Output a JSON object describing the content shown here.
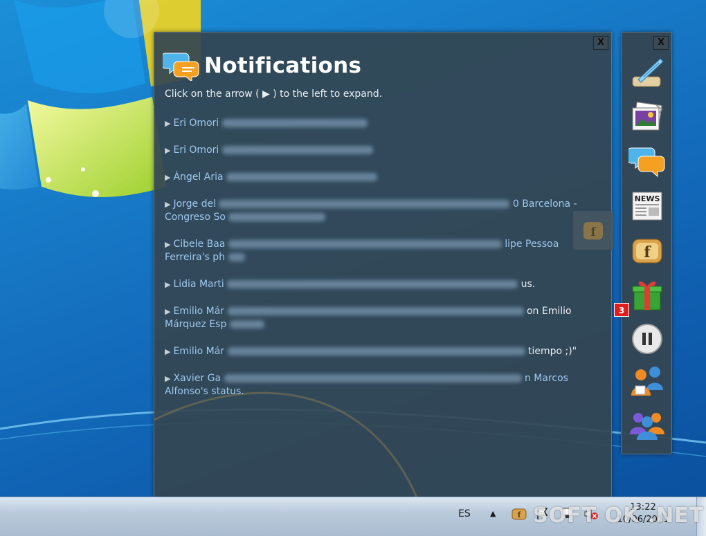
{
  "panel": {
    "title": "Notifications",
    "close_label": "X",
    "instruction": "Click on the arrow ( ▶ ) to the left to expand."
  },
  "notifications": [
    {
      "arrow": "▶",
      "name": "Eri Omori",
      "tail": "",
      "line2": ""
    },
    {
      "arrow": "▶",
      "name": "Eri Omori",
      "tail": "",
      "line2": ""
    },
    {
      "arrow": "▶",
      "name": "Ángel Aria",
      "tail": "",
      "line2": ""
    },
    {
      "arrow": "▶",
      "name": "Jorge del",
      "tail": "0 Barcelona -",
      "line2": "Congreso So"
    },
    {
      "arrow": "▶",
      "name": "Cibele Baa",
      "tail": "lipe Pessoa",
      "line2": "Ferreira's ph"
    },
    {
      "arrow": "▶",
      "name": "Lidia Marti",
      "tail": "us.",
      "line2": ""
    },
    {
      "arrow": "▶",
      "name": "Emilio Már",
      "tail": "on Emilio",
      "line2": "Márquez Esp"
    },
    {
      "arrow": "▶",
      "name": "Emilio Már",
      "tail": "tiempo ;)\"",
      "line2": ""
    },
    {
      "arrow": "▶",
      "name": "Xavier Ga",
      "tail": "n Marcos",
      "line2": "Alfonso's status."
    }
  ],
  "sidebar": {
    "close_label": "X",
    "tools": [
      {
        "icon": "quill-scroll-icon"
      },
      {
        "icon": "photo-icon"
      },
      {
        "icon": "chat-bubbles-icon"
      },
      {
        "icon": "news-icon"
      },
      {
        "icon": "facebook-toast-icon"
      },
      {
        "icon": "gift-icon"
      },
      {
        "icon": "pause-icon"
      },
      {
        "icon": "friends-icon"
      },
      {
        "icon": "groups-icon"
      }
    ],
    "gift_badge": "3"
  },
  "taskbar": {
    "language": "ES",
    "tray_expand": "▲",
    "clock_time": "13:22",
    "clock_date": "10/06/2011"
  },
  "watermark": "SOFT OK .NET",
  "colors": {
    "link": "#9fc8ef",
    "panel_bg": "#344652",
    "badge": "#e21d1d"
  }
}
